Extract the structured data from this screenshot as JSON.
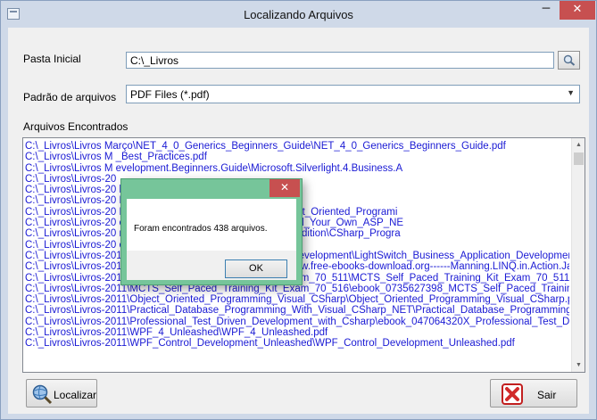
{
  "window": {
    "title": "Localizando Arquivos",
    "minimize_glyph": "─",
    "close_glyph": "✕"
  },
  "form": {
    "pasta_label": "Pasta Inicial",
    "pasta_value": "C:\\_Livros",
    "padrao_label": "Padrão de arquivos",
    "padrao_value": "PDF Files (*.pdf)",
    "arquivos_label": "Arquivos  Encontrados"
  },
  "files": [
    "C:\\_Livros\\Livros Março\\NET_4_0_Generics_Beginners_Guide\\NET_4_0_Generics_Beginners_Guide.pdf",
    "C:\\_Livros\\Livros M                                                                          _Best_Practices.pdf",
    "C:\\_Livros\\Livros M                                                                    evelopment.Beginners.Guide\\Microsoft.Silverlight.4.Business.A",
    "C:\\_Livros\\Livros-20",
    "C:\\_Livros\\Livros-20                                                                k.2nd.Edition.Aug.2010.pdf",
    "C:\\_Livros\\Livros-20                                                                B.pdf",
    "C:\\_Livros\\Livros-20                                                                Programming\\Beginning_CSharp_Object_Oriented_Programi",
    "C:\\_Livros\\Livros-20                                                                e_4th_Edition\\ebook_0987090860_Build_Your_Own_ASP_NE",
    "C:\\_Livros\\Livros-20                                                                m_Analysis_to_Program_Design_3rd_Edition\\CSharp_Progra",
    "C:\\_Livros\\Livros-20                                                                ook_0735649928_Coding_Faster.pdf",
    "C:\\_Livros\\Livros-2011\\LightSwitch_Business_Application_Development\\LightSwitch_Business_Application_Development",
    "C:\\_Livros\\Livros-2011\\Manning.LINQ.in.Action.Jan.2008\\www.free-ebooks-download.org------Manning.LINQ.in.Action.Jan.2008.",
    "C:\\_Livros\\Livros-2011\\MCTS_Self_Paced_Training_Kit_Exam_70_511\\MCTS_Self_Paced_Training_Kit_Exam_70_511.pd",
    "C:\\_Livros\\Livros-2011\\MCTS_Self_Paced_Training_Kit_Exam_70_516\\ebook_0735627398_MCTS_Self_Paced_Training_K",
    "C:\\_Livros\\Livros-2011\\Object_Oriented_Programming_Visual_CSharp\\Object_Oriented_Programming_Visual_CSharp.pd",
    "C:\\_Livros\\Livros-2011\\Practical_Database_Programming_With_Visual_CSharp_NET\\Practical_Database_Programming_",
    "C:\\_Livros\\Livros-2011\\Professional_Test_Driven_Development_with_Csharp\\ebook_047064320X_Professional_Test_Dri",
    "C:\\_Livros\\Livros-2011\\WPF_4_Unleashed\\WPF_4_Unleashed.pdf",
    "C:\\_Livros\\Livros-2011\\WPF_Control_Development_Unleashed\\WPF_Control_Development_Unleashed.pdf"
  ],
  "buttons": {
    "localizar": "Localizar",
    "sair": "Sair"
  },
  "dialog": {
    "message": "Foram encontrados 438 arquivos.",
    "ok_label": "OK",
    "close_glyph": "✕"
  },
  "icons": {
    "browse": "magnifier-icon",
    "localizar": "search-globe-icon",
    "sair": "exit-x-icon"
  },
  "colors": {
    "list_text": "#1a1ad4",
    "dialog_frame": "#76c59a",
    "close_button": "#c75050"
  }
}
